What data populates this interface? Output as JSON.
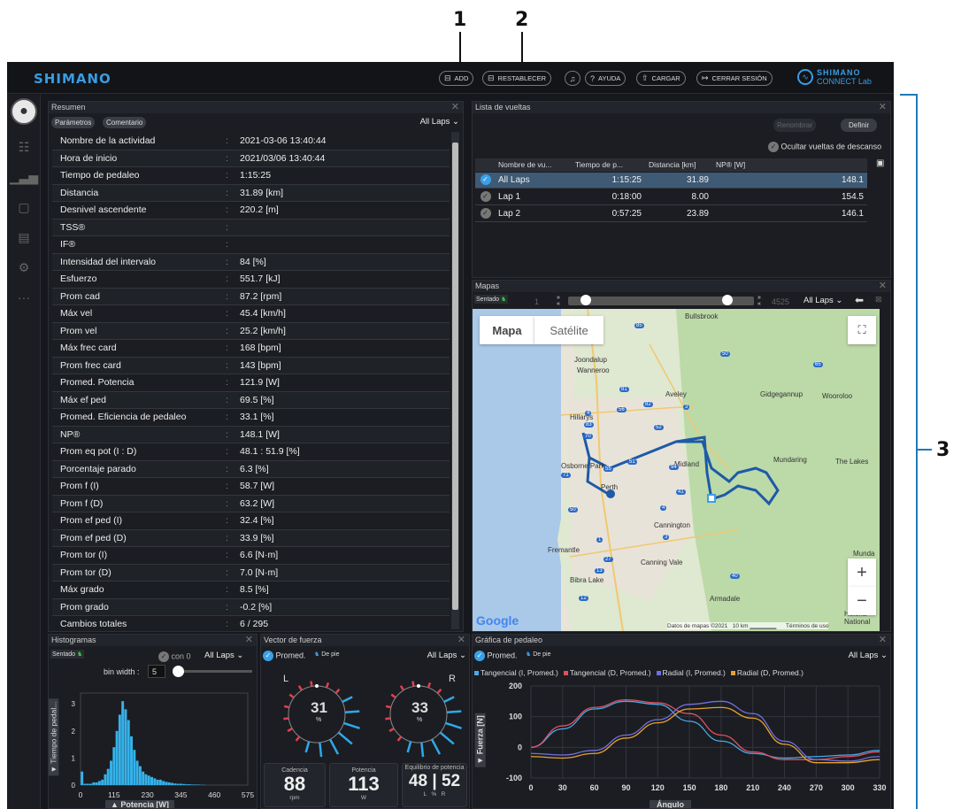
{
  "callouts": [
    "1",
    "2",
    "3"
  ],
  "header": {
    "logo": "SHIMANO",
    "brand_line1": "SHIMANO",
    "brand_line2": "CONNECT Lab",
    "buttons": [
      {
        "label": "ADD",
        "icon": "add-icon"
      },
      {
        "label": "RESTABLECER",
        "icon": "reset-icon"
      },
      {
        "label": "",
        "icon": "bell-icon"
      },
      {
        "label": "AYUDA",
        "icon": "help-icon"
      },
      {
        "label": "CARGAR",
        "icon": "upload-icon"
      },
      {
        "label": "CERRAR SESIÓN",
        "icon": "logout-icon"
      }
    ]
  },
  "summary": {
    "title": "Resumen",
    "tab1": "Parámetros",
    "tab2": "Comentario",
    "laps": "All Laps ⌄",
    "rows": [
      {
        "k": "Nombre de la actividad",
        "v": "2021-03-06 13:40:44"
      },
      {
        "k": "Hora de inicio",
        "v": "2021/03/06 13:40:44"
      },
      {
        "k": "Tiempo de pedaleo",
        "v": "1:15:25"
      },
      {
        "k": "Distancia",
        "v": "31.89 [km]"
      },
      {
        "k": "Desnivel ascendente",
        "v": "220.2 [m]"
      },
      {
        "k": "TSS®",
        "v": ""
      },
      {
        "k": "IF®",
        "v": ""
      },
      {
        "k": "Intensidad del intervalo",
        "v": "84 [%]"
      },
      {
        "k": "Esfuerzo",
        "v": "551.7 [kJ]"
      },
      {
        "k": "Prom cad",
        "v": "87.2 [rpm]"
      },
      {
        "k": "Máx vel",
        "v": "45.4 [km/h]"
      },
      {
        "k": "Prom vel",
        "v": "25.2 [km/h]"
      },
      {
        "k": "Máx frec card",
        "v": "168 [bpm]"
      },
      {
        "k": "Prom frec card",
        "v": "143 [bpm]"
      },
      {
        "k": "Promed. Potencia",
        "v": "121.9 [W]"
      },
      {
        "k": "Máx ef ped",
        "v": "69.5 [%]"
      },
      {
        "k": "Promed. Eficiencia de pedaleo",
        "v": "33.1 [%]"
      },
      {
        "k": "NP®",
        "v": "148.1 [W]"
      },
      {
        "k": "Prom eq pot (I : D)",
        "v": "48.1 : 51.9 [%]"
      },
      {
        "k": "Porcentaje parado",
        "v": "6.3 [%]"
      },
      {
        "k": "Prom f (I)",
        "v": "58.7 [W]"
      },
      {
        "k": "Prom f (D)",
        "v": "63.2 [W]"
      },
      {
        "k": "Prom ef ped (I)",
        "v": "32.4 [%]"
      },
      {
        "k": "Prom ef ped (D)",
        "v": "33.9 [%]"
      },
      {
        "k": "Prom tor (I)",
        "v": "6.6 [N·m]"
      },
      {
        "k": "Prom tor (D)",
        "v": "7.0 [N·m]"
      },
      {
        "k": "Máx grado",
        "v": "8.5 [%]"
      },
      {
        "k": "Prom grado",
        "v": "-0.2 [%]"
      },
      {
        "k": "Cambios totales",
        "v": "6 / 295"
      }
    ]
  },
  "laps": {
    "title": "Lista de vueltas",
    "rename": "Renombrar",
    "define": "Definir",
    "hide_rest": "Ocultar vueltas de descanso",
    "columns": [
      "Nombre de vu...",
      "Tiempo de p...",
      "Distancia [km]",
      "NP® [W]"
    ],
    "rows": [
      {
        "name": "All Laps",
        "time": "1:15:25",
        "dist": "31.89",
        "np": "148.1"
      },
      {
        "name": "Lap 1",
        "time": "0:18:00",
        "dist": "8.00",
        "np": "154.5"
      },
      {
        "name": "Lap 2",
        "time": "0:57:25",
        "dist": "23.89",
        "np": "146.1"
      }
    ]
  },
  "maps": {
    "title": "Mapas",
    "posture": "Sentado",
    "start": "1",
    "end": "4525",
    "laps": "All Laps ⌄",
    "tab_map": "Mapa",
    "tab_sat": "Satélite",
    "google": "Google",
    "attrib": "Datos de mapas ©2021",
    "scale": "10 km",
    "terms": "Términos de uso",
    "places": [
      "Bullsbrook",
      "Joondalup",
      "Wanneroo",
      "Hillarys",
      "Aveley",
      "Gidgegannup",
      "Wooroloo",
      "Midland",
      "Mundaring",
      "The Lakes",
      "Osborne Park",
      "Perth",
      "Fremantle",
      "Cannington",
      "Canning Vale",
      "Bibra Lake",
      "Armadale",
      "Helena National",
      "Munda"
    ],
    "roads": [
      "85",
      "50",
      "65",
      "81",
      "56",
      "82",
      "4",
      "52",
      "3",
      "83",
      "70",
      "51",
      "55",
      "71",
      "94",
      "41",
      "50",
      "1",
      "27",
      "3",
      "4",
      "13",
      "12",
      "40"
    ]
  },
  "histogram": {
    "title": "Histogramas",
    "posture": "Sentado",
    "con0": "con 0",
    "laps": "All Laps ⌄",
    "bin_label": "bin width :",
    "bin_value": "5",
    "y_label": "▼ Tiempo de pedal...",
    "x_label": "▲ Potencia [W]",
    "chart_data": {
      "type": "bar",
      "title": "",
      "xlabel": "Potencia [W]",
      "ylabel": "Tiempo de pedal...",
      "xlim": [
        0,
        575
      ],
      "ylim": [
        0,
        3.4
      ],
      "xticks": [
        0,
        115,
        230,
        345,
        460,
        575
      ],
      "yticks": [
        0,
        1,
        2,
        3
      ],
      "x": [
        5,
        15,
        25,
        35,
        45,
        55,
        65,
        75,
        85,
        95,
        105,
        115,
        125,
        135,
        145,
        155,
        165,
        175,
        185,
        195,
        205,
        215,
        225,
        235,
        245,
        255,
        265,
        275,
        285,
        295,
        305,
        315,
        325,
        335,
        345,
        355,
        365,
        375,
        385,
        395,
        405,
        415,
        425
      ],
      "values": [
        0.5,
        0.05,
        0.05,
        0.05,
        0.1,
        0.1,
        0.15,
        0.2,
        0.4,
        0.6,
        0.9,
        1.4,
        2.0,
        2.6,
        3.1,
        2.8,
        2.4,
        1.8,
        1.3,
        0.9,
        0.7,
        0.5,
        0.4,
        0.35,
        0.3,
        0.25,
        0.2,
        0.2,
        0.15,
        0.12,
        0.1,
        0.08,
        0.06,
        0.05,
        0.05,
        0.04,
        0.03,
        0.03,
        0.02,
        0.02,
        0.02,
        0.01,
        0.01
      ]
    }
  },
  "force": {
    "title": "Vector de fuerza",
    "promed": "Promed.",
    "posture": "De pie",
    "laps": "All Laps ⌄",
    "left_label": "L",
    "right_label": "R",
    "left_value": "31",
    "right_value": "33",
    "pct": "%",
    "cad_label": "Cadencia",
    "cad_value": "88",
    "cad_unit": "rpm",
    "pow_label": "Potencia",
    "pow_value": "113",
    "pow_unit": "W",
    "bal_label": "Equilibrio de potencia",
    "bal_left": "48",
    "bal_right": "52",
    "bal_l": "L",
    "bal_pct": "%",
    "bal_r": "R"
  },
  "pedal": {
    "title": "Gráfica de pedaleo",
    "promed": "Promed.",
    "posture": "De pie",
    "laps": "All Laps ⌄",
    "y_label": "▼ Fuerza [N]",
    "x_label": "Ángulo",
    "colors": {
      "tl": "#4aa8e8",
      "tr": "#e05060",
      "rl": "#7070e0",
      "rr": "#e8a030"
    },
    "chart_data": {
      "type": "line",
      "title": "",
      "xlabel": "Ángulo",
      "ylabel": "Fuerza [N]",
      "xlim": [
        0,
        330
      ],
      "ylim": [
        -100,
        200
      ],
      "xticks": [
        0,
        30,
        60,
        90,
        120,
        150,
        180,
        210,
        240,
        270,
        300,
        330
      ],
      "yticks": [
        200,
        100,
        0,
        -100
      ],
      "x": [
        0,
        30,
        60,
        90,
        120,
        150,
        180,
        210,
        240,
        270,
        300,
        330
      ],
      "series": [
        {
          "name": "Tangencial (I, Promed.)",
          "values": [
            0,
            60,
            125,
            150,
            140,
            85,
            20,
            -20,
            -35,
            -30,
            -25,
            -10
          ]
        },
        {
          "name": "Tangencial (D, Promed.)",
          "values": [
            0,
            70,
            130,
            155,
            145,
            110,
            40,
            -15,
            -40,
            -40,
            -30,
            -15
          ]
        },
        {
          "name": "Radial (I, Promed.)",
          "values": [
            -20,
            -25,
            -10,
            40,
            90,
            140,
            150,
            110,
            20,
            -40,
            -45,
            -30
          ]
        },
        {
          "name": "Radial (D, Promed.)",
          "values": [
            -30,
            -35,
            -20,
            30,
            80,
            125,
            130,
            95,
            10,
            -50,
            -50,
            -40
          ]
        }
      ]
    }
  }
}
